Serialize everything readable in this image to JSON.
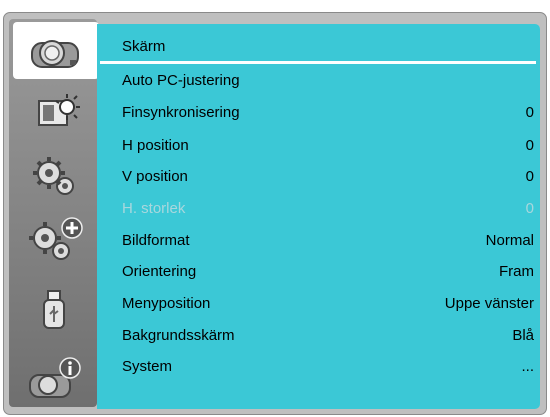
{
  "menu": {
    "title": "Skärm",
    "items": [
      {
        "label": "Auto PC-justering",
        "value": ""
      },
      {
        "label": "Finsynkronisering",
        "value": "0"
      },
      {
        "label": "H position",
        "value": "0"
      },
      {
        "label": "V position",
        "value": "0"
      },
      {
        "label": "H. storlek",
        "value": "0",
        "disabled": true
      },
      {
        "label": "Bildformat",
        "value": "Normal"
      },
      {
        "label": "Orientering",
        "value": "Fram"
      },
      {
        "label": "Menyposition",
        "value": "Uppe vänster"
      },
      {
        "label": "Bakgrundsskärm",
        "value": "Blå"
      },
      {
        "label": "System",
        "value": "..."
      }
    ]
  },
  "sidebar": {
    "tabs": [
      {
        "icon": "projector-icon",
        "active": true
      },
      {
        "icon": "image-brightness-icon"
      },
      {
        "icon": "gears-icon"
      },
      {
        "icon": "gears-plus-icon"
      },
      {
        "icon": "usb-drive-icon"
      },
      {
        "icon": "projector-info-icon"
      }
    ]
  },
  "colors": {
    "panel": "#3bc8d6",
    "disabled_text": "#a8d7dd",
    "frame": "#bfbfbf"
  }
}
